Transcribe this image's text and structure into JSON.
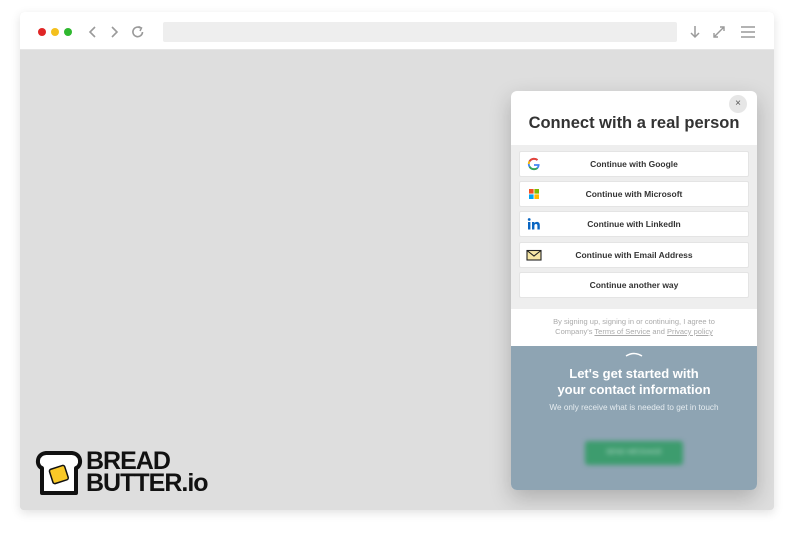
{
  "colors": {
    "dot_red": "#e02626",
    "dot_yellow": "#f4c01e",
    "dot_green": "#2fb82f",
    "panel_blue": "#8ea4b3",
    "send_green": "#3d9c6e",
    "logo_yellow": "#f9c927"
  },
  "browser": {
    "icons": [
      "back-icon",
      "forward-icon",
      "reload-icon",
      "download-icon",
      "fullscreen-icon",
      "menu-icon"
    ]
  },
  "logo": {
    "line1": "BREAD",
    "line2": "BUTTER.io"
  },
  "modal": {
    "close_label": "×",
    "title": "Connect with a real person",
    "options": [
      {
        "label": "Continue with Google",
        "icon": "google-icon"
      },
      {
        "label": "Continue with Microsoft",
        "icon": "microsoft-icon"
      },
      {
        "label": "Continue with LinkedIn",
        "icon": "linkedin-icon"
      },
      {
        "label": "Continue with Email Address",
        "icon": "envelope-icon"
      },
      {
        "label": "Continue another way",
        "icon": ""
      }
    ],
    "legal": {
      "text1": "By signing up, signing in or continuing, I agree to",
      "text2": "Company's",
      "terms": "Terms of Service",
      "and": "and",
      "privacy": "Privacy policy"
    },
    "bottom": {
      "title_line1": "Let's get started with",
      "title_line2": "your contact information",
      "subtitle": "We only receive what is needed to get in touch",
      "send_button": "SEND MESSAGE"
    }
  }
}
